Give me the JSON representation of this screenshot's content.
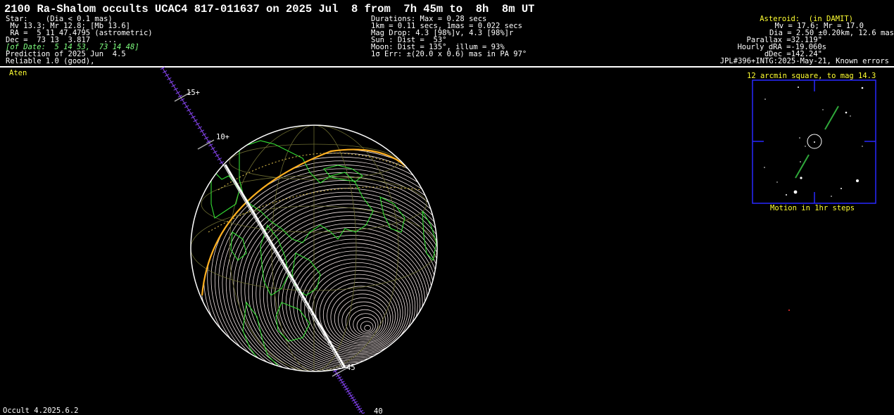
{
  "title": "2100 Ra-Shalom occults UCAC4 817-011637 on 2025 Jul  8 from  7h 45m to  8h  8m UT",
  "star": {
    "lines": [
      "Star:    (Dia < 0.1 mas)",
      " Mv 13.3; Mr 12.8; [Mb 13.6]",
      " RA =  5 11 47.4795 (astrometric)",
      "Dec =  73 13  3.817   ...",
      "[of Date:  5 14 53,  73 14 48]",
      "Prediction of 2025 Jun  4.5",
      "Reliable 1.0 (good),"
    ]
  },
  "event": {
    "lines": [
      "Durations: Max = 0.28 secs",
      "1km = 0.11 secs, 1mas = 0.022 secs",
      "Mag Drop: 4.3 [98%]v, 4.3 [98%]r",
      "Sun : Dist =  53°",
      "Moon: Dist = 135°, illum = 93%",
      "1σ Err: ±(20.0 x 0.6) mas in PA 97°"
    ]
  },
  "asteroid": {
    "header": "Asteroid:  (in DAMIT)",
    "lines": [
      "Mv = 17.6; Mr = 17.0",
      "Dia = 2.50 ±0.20km, 12.6 mas",
      "Parallax =32.119\"",
      "Hourly dRA =-19.060s",
      "dDec =142.24\"",
      "JPL#396+INTG:2025-May-21, Known errors"
    ]
  },
  "orbit_class": "Aten",
  "path_labels": [
    "15+",
    "10+",
    "45",
    "40"
  ],
  "starchart": {
    "title": "12 arcmin square, to mag 14.3",
    "caption": "Motion in 1hr steps"
  },
  "footer": "Occult 4.2025.6.2",
  "colors": {
    "background": "#000000",
    "text": "#ffffff",
    "highlight": "#ffff33",
    "coastline": "#33dd33",
    "path": "#ffffff",
    "limb": "#ffb020",
    "frame": "#2020ff"
  }
}
